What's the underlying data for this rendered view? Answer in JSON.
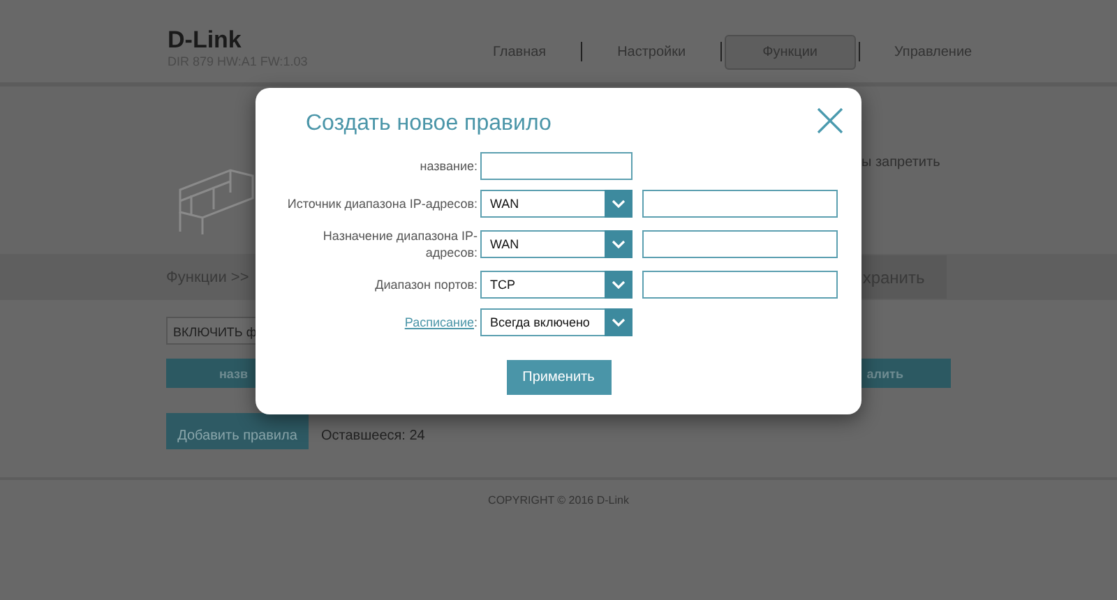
{
  "header": {
    "logo": "D-Link",
    "model": "DIR 879 HW:A1 FW:1.03",
    "nav": [
      {
        "label": "Главная",
        "selected": false
      },
      {
        "label": "Настройки",
        "selected": false
      },
      {
        "label": "Функции",
        "selected": true
      },
      {
        "label": "Управление",
        "selected": false
      }
    ]
  },
  "intro_fragment": "ы запретить",
  "breadcrumb": "Функции >>",
  "save_button": "хранить",
  "filter_select": "ВКЛЮЧИТЬ ф",
  "table": {
    "columns": [
      "назв",
      "алить"
    ]
  },
  "add_button": "Добавить правила",
  "remaining": "Оставшееся: 24",
  "footer": "COPYRIGHT © 2016 D-Link",
  "dialog": {
    "title": "Создать новое правило",
    "fields": [
      {
        "kind": "text",
        "label": "название:"
      },
      {
        "kind": "select_range",
        "label": "Источник диапазона IP-адресов:",
        "value": "WAN"
      },
      {
        "kind": "select_range",
        "label": "Назначение диапазона IP-адресов:",
        "value": "WAN"
      },
      {
        "kind": "select_range",
        "label": "Диапазон портов:",
        "value": "TCP"
      },
      {
        "kind": "select",
        "label": "Расписание",
        "link": true,
        "suffix": ":",
        "value": "Всегда включено"
      }
    ],
    "apply": "Применить"
  }
}
